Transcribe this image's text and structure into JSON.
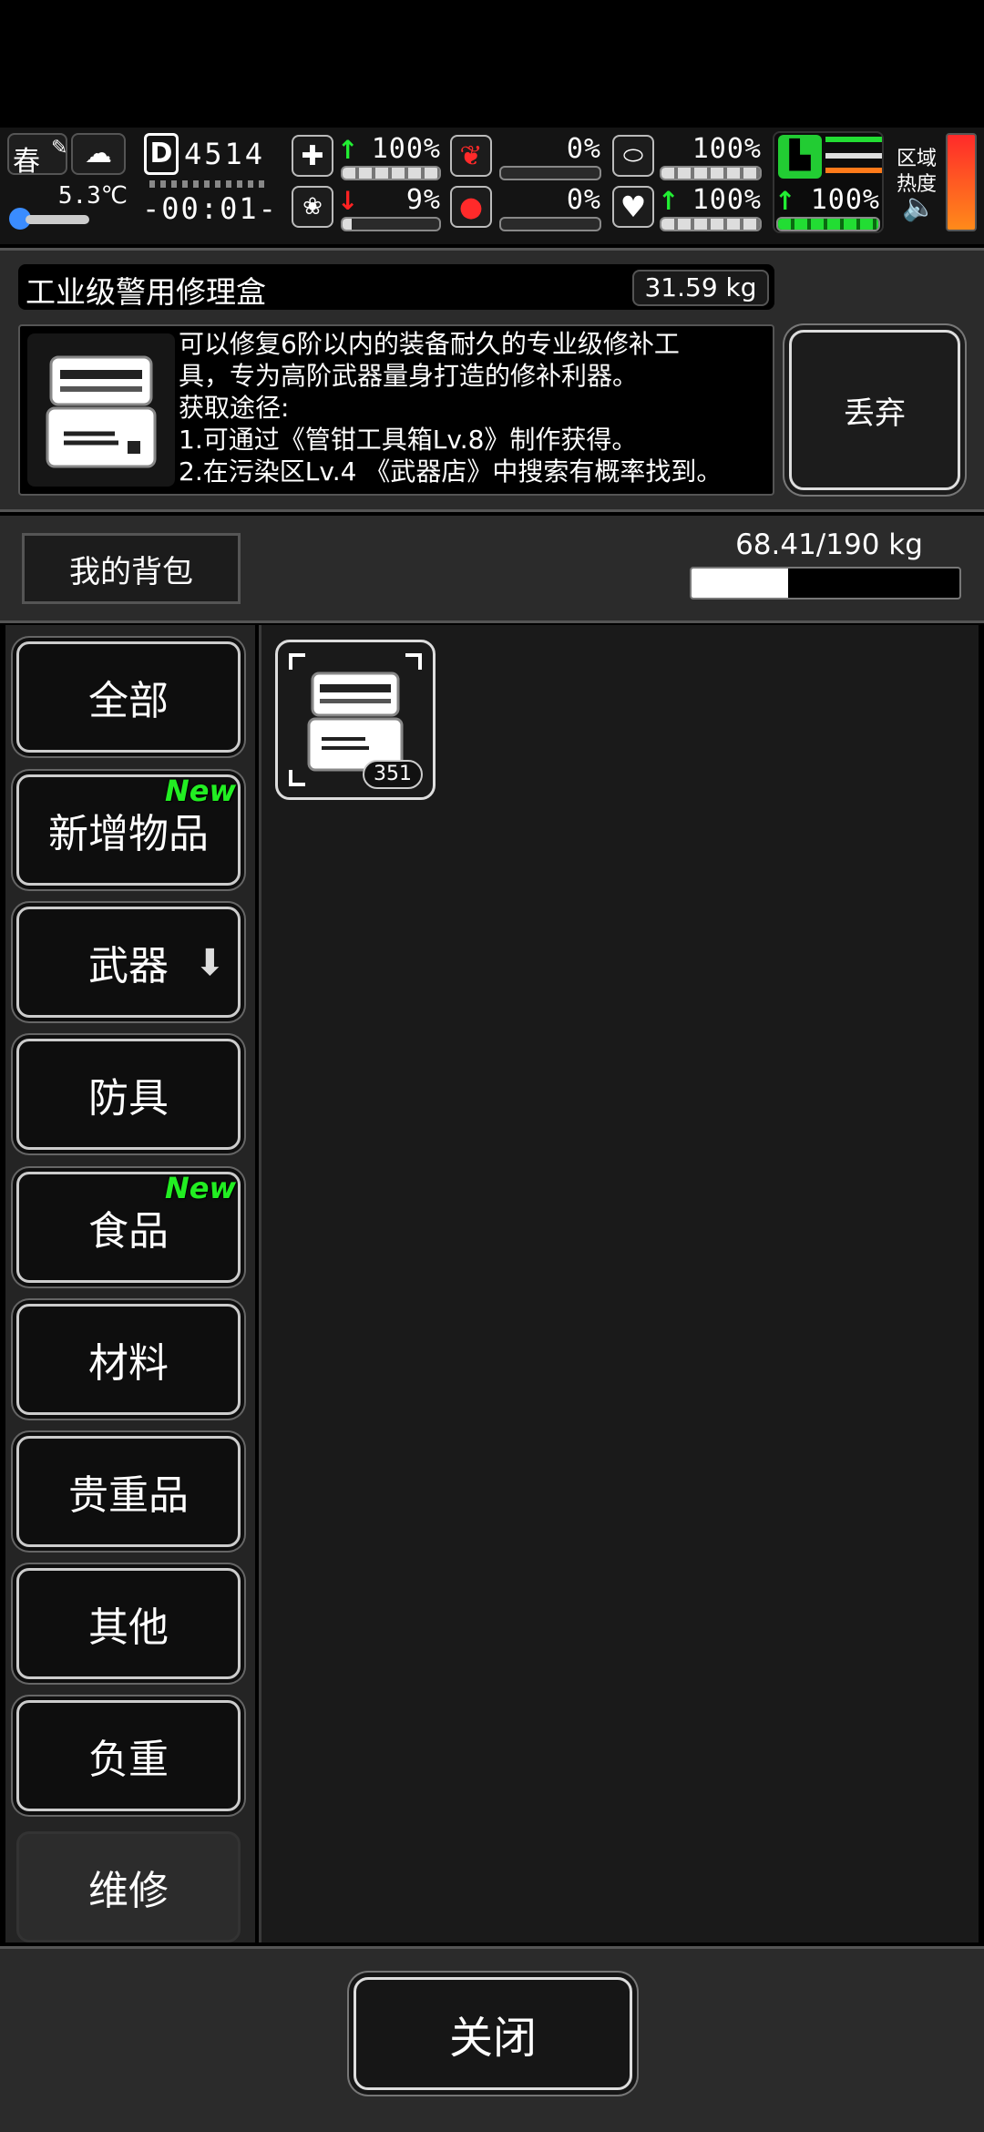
{
  "status": {
    "season": "春",
    "temperature": "5.3℃",
    "day_counter": "4514",
    "clock": "-00:01-",
    "health_pct": "100%",
    "hunger_pct": "0%",
    "stamina_pct": "100%",
    "mood_pct": "9%",
    "thirst_pct": "0%",
    "heart_pct": "100%",
    "speed_pct": "100%",
    "zone_heat_label_1": "区域",
    "zone_heat_label_2": "热度",
    "levels": {
      "health": 1.0,
      "hunger": 0.0,
      "stamina": 1.0,
      "mood": 0.09,
      "thirst": 0.0,
      "heart": 1.0,
      "speed": 1.0
    }
  },
  "item": {
    "name": "工业级警用修理盒",
    "weight": "31.59 kg",
    "desc_lines": [
      "可以修复6阶以内的装备耐久的专业级修补工",
      "具，专为高阶武器量身打造的修补利器。",
      "获取途径:",
      "1.可通过《管钳工具箱Lv.8》制作获得。",
      "2.在污染区Lv.4 《武器店》中搜索有概率找到。"
    ],
    "drop_label": "丢弃"
  },
  "bag": {
    "label": "我的背包",
    "weight_text": "68.41/190 kg",
    "fill": 0.36
  },
  "categories": [
    {
      "label": "全部",
      "new": false
    },
    {
      "label": "新增物品",
      "new": true,
      "tag": "New"
    },
    {
      "label": "武器",
      "new": false
    },
    {
      "label": "防具",
      "new": false
    },
    {
      "label": "食品",
      "new": true,
      "tag": "New"
    },
    {
      "label": "材料",
      "new": false
    },
    {
      "label": "贵重品",
      "new": false
    },
    {
      "label": "其他",
      "new": false
    },
    {
      "label": "负重",
      "new": false
    },
    {
      "label": "维修",
      "new": false,
      "selected": true
    }
  ],
  "grid": {
    "slot_count": "351"
  },
  "close_label": "关闭"
}
